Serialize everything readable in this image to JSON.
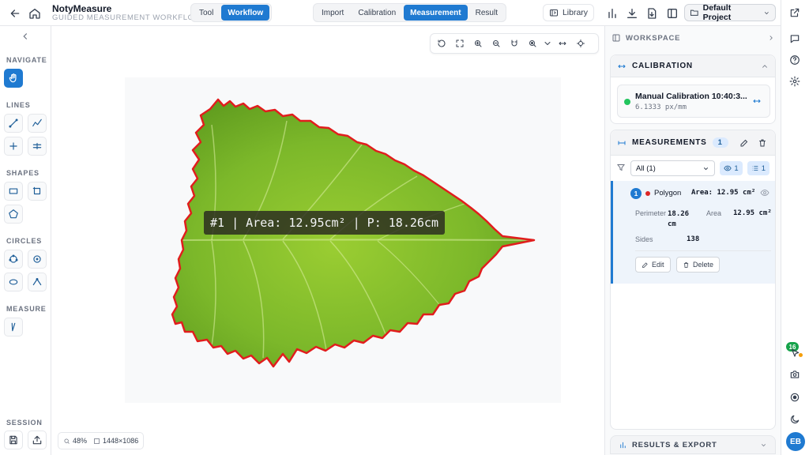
{
  "app": {
    "title": "NotyMeasure",
    "subtitle": "GUIDED MEASUREMENT WORKFLOW"
  },
  "mode_switch": [
    {
      "label": "Tool",
      "active": false
    },
    {
      "label": "Workflow",
      "active": true
    }
  ],
  "workflow_steps": [
    {
      "label": "Import",
      "active": false
    },
    {
      "label": "Calibration",
      "active": false
    },
    {
      "label": "Measurement",
      "active": true
    },
    {
      "label": "Result",
      "active": false
    }
  ],
  "header": {
    "library_label": "Library",
    "project_label": "Default Project"
  },
  "toolbar": {
    "sections": {
      "navigate": "NAVIGATE",
      "lines": "LINES",
      "shapes": "SHAPES",
      "circles": "CIRCLES",
      "measure": "MEASURE",
      "session": "SESSION"
    }
  },
  "canvas": {
    "measurement_label": "#1 | Area: 12.95cm² | P: 18.26cm",
    "zoom": "48%",
    "image_size": "1448×1086"
  },
  "panel": {
    "workspace_title": "WORKSPACE",
    "calibration": {
      "title": "CALIBRATION",
      "item_name": "Manual Calibration 10:40:3...",
      "item_scale": "6.1333 px/mm"
    },
    "measurements": {
      "title": "MEASUREMENTS",
      "count": "1",
      "filter_value": "All (1)",
      "visible_count": "1",
      "list_count": "1",
      "items": [
        {
          "number": "1",
          "type": "Polygon",
          "area_summary": "Area: 12.95 cm²",
          "perimeter_label": "Perimeter",
          "perimeter_value": "18.26 cm",
          "area_label": "Area",
          "area_value": "12.95 cm²",
          "sides_label": "Sides",
          "sides_value": "138",
          "edit_label": "Edit",
          "delete_label": "Delete"
        }
      ]
    },
    "results_title": "RESULTS & EXPORT"
  },
  "rail": {
    "notification_count": "16",
    "avatar_initials": "EB"
  },
  "colors": {
    "accent": "#1f7ad1",
    "outline": "#e11d1d",
    "status_green": "#22c55e"
  }
}
